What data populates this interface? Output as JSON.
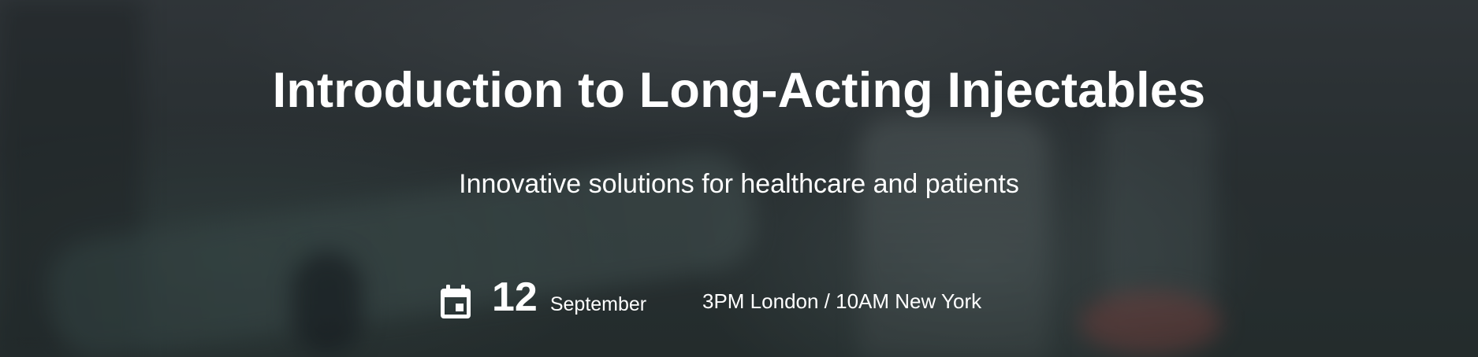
{
  "hero": {
    "title": "Introduction to Long-Acting Injectables",
    "subtitle": "Innovative solutions for healthcare and patients"
  },
  "event": {
    "icon": "calendar-icon",
    "day": "12",
    "month": "September",
    "time": "3PM London / 10AM New York"
  },
  "colors": {
    "text": "#ffffff",
    "background_overlay": "#2b3134"
  }
}
